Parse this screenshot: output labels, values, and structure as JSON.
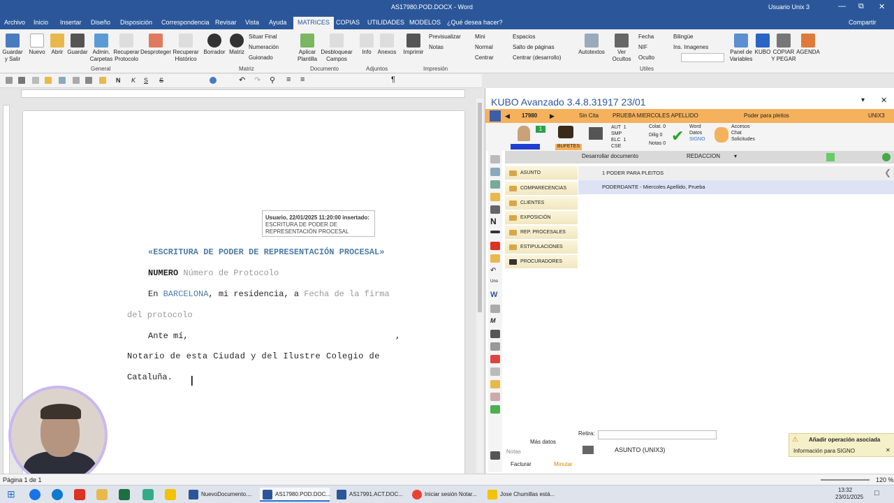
{
  "window": {
    "title": "AS17980.POD.DOCX - Word",
    "user": "Usuario Unix 3",
    "share": "Compartir"
  },
  "tabs": [
    "Archivo",
    "Inicio",
    "Insertar",
    "Diseño",
    "Disposición",
    "Correspondencia",
    "Revisar",
    "Vista",
    "Ayuda",
    "MATRICES",
    "COPIAS",
    "UTILIDADES",
    "MODELOS",
    "¿Qué desea hacer?"
  ],
  "ribbon": {
    "buttons": [
      "Guardar y Salir",
      "Nuevo",
      "Abrir",
      "Guardar",
      "Admin. Carpetas",
      "Recuperar Protocolo",
      "Desproteger",
      "Recuperar Histórico",
      "Borrador",
      "Matriz",
      "Aplicar Plantilla",
      "Desbloquear Campos",
      "Info",
      "Anexos",
      "Imprimir",
      "Autotextos",
      "Ver Ocultos",
      "Panel de Variables",
      "KUBO",
      "COPIAR Y PEGAR",
      "AGENDA"
    ],
    "small": [
      "Situar Final",
      "Numeración",
      "Guionado",
      "Previsualizar",
      "Notas",
      "Mini",
      "Normal",
      "Centrar",
      "Espacios",
      "Salto de páginas",
      "Centrar (desarrollo)",
      "Fecha",
      "NIF",
      "Oculto",
      "Bilingüe",
      "Ins. Imagenes"
    ],
    "groups": [
      "General",
      "Matriz",
      "Documento",
      "Adjuntos",
      "Impresión",
      "Utiles"
    ]
  },
  "document": {
    "tooltip": {
      "header": "Usuario, 22/01/2025 11:20:00 insertado:",
      "body": "ESCRITURA DE PODER DE REPRESENTACIÓN PROCESAL"
    },
    "title": "«ESCRITURA DE PODER DE REPRESENTACIÓN PROCESAL»",
    "numero_label": "NUMERO",
    "numero_field": "Número de Protocolo",
    "line_en": "En",
    "city": "BARCELONA",
    "residencia": ", mi residencia, a",
    "fecha_field": "Fecha de la firma",
    "fecha_field2": "del protocolo",
    "ante": "Ante  mí,",
    "comma": ",",
    "notario": "Notario de esta Ciudad y del Ilustre Colegio de",
    "cataluna": "Cataluña."
  },
  "statusbar": {
    "page": "Página 1 de 1",
    "zoom": "120 %"
  },
  "kubo": {
    "title": "KUBO Avanzado 3.4.8.31917   23/01",
    "bar": {
      "number": "17980",
      "cita": "Sin Cita",
      "client": "PRUEBA MIERCOLES APELLIDO",
      "tipo": "Poder para pleitos",
      "user": "UNIX3"
    },
    "badge": "1",
    "bufetes": "BUFETES",
    "codes": "AUT  1\nSMP\nELC  1\nCSE",
    "colat": "Colat. 0",
    "dilig": "Dilig 0",
    "notas": "Notas 0",
    "word": "Word",
    "datos": "Datos",
    "signo": "SIGNO",
    "accesos": "Accesos",
    "chat": "Chat",
    "solicitudes": "Solicitudes",
    "desarrollar": "Desarrollar documento",
    "redaccion": "REDACCION",
    "tree": [
      "ASUNTO",
      "COMPARECENCIAS",
      "CLIENTES AUTORIZADOS",
      "EXPOSICIÓN",
      "REP. PROCESALES",
      "ESTIPULACIONES",
      "PROCURADORES"
    ],
    "content": [
      "1 PODER PARA PLEITOS",
      "PODERDANTE - Miercoles Apellido, Prueba"
    ],
    "retira": "Retira:",
    "mas_datos": "Más datos",
    "notas_label": "Notas",
    "facturar": "Facturar",
    "minutar": "Minutar",
    "asunto_footer": "ASUNTO (UNIX3)",
    "signo_panel": {
      "add": "Añadir operación asociada",
      "info": "Información para SIGNO"
    }
  },
  "taskbar": {
    "tasks": [
      "NuevoDocumento....",
      "AS17980.POD.DOC...",
      "AS17991.ACT.DOC...",
      "Iniciar sesión Notar...",
      "Jose Chumillas está..."
    ],
    "time": "13:32",
    "date": "23/01/2025"
  },
  "colors": {
    "word_blue": "#2b579a",
    "kubo_orange": "#f5b15c",
    "field_gray": "#999999",
    "city_blue": "#4e7ca6"
  }
}
